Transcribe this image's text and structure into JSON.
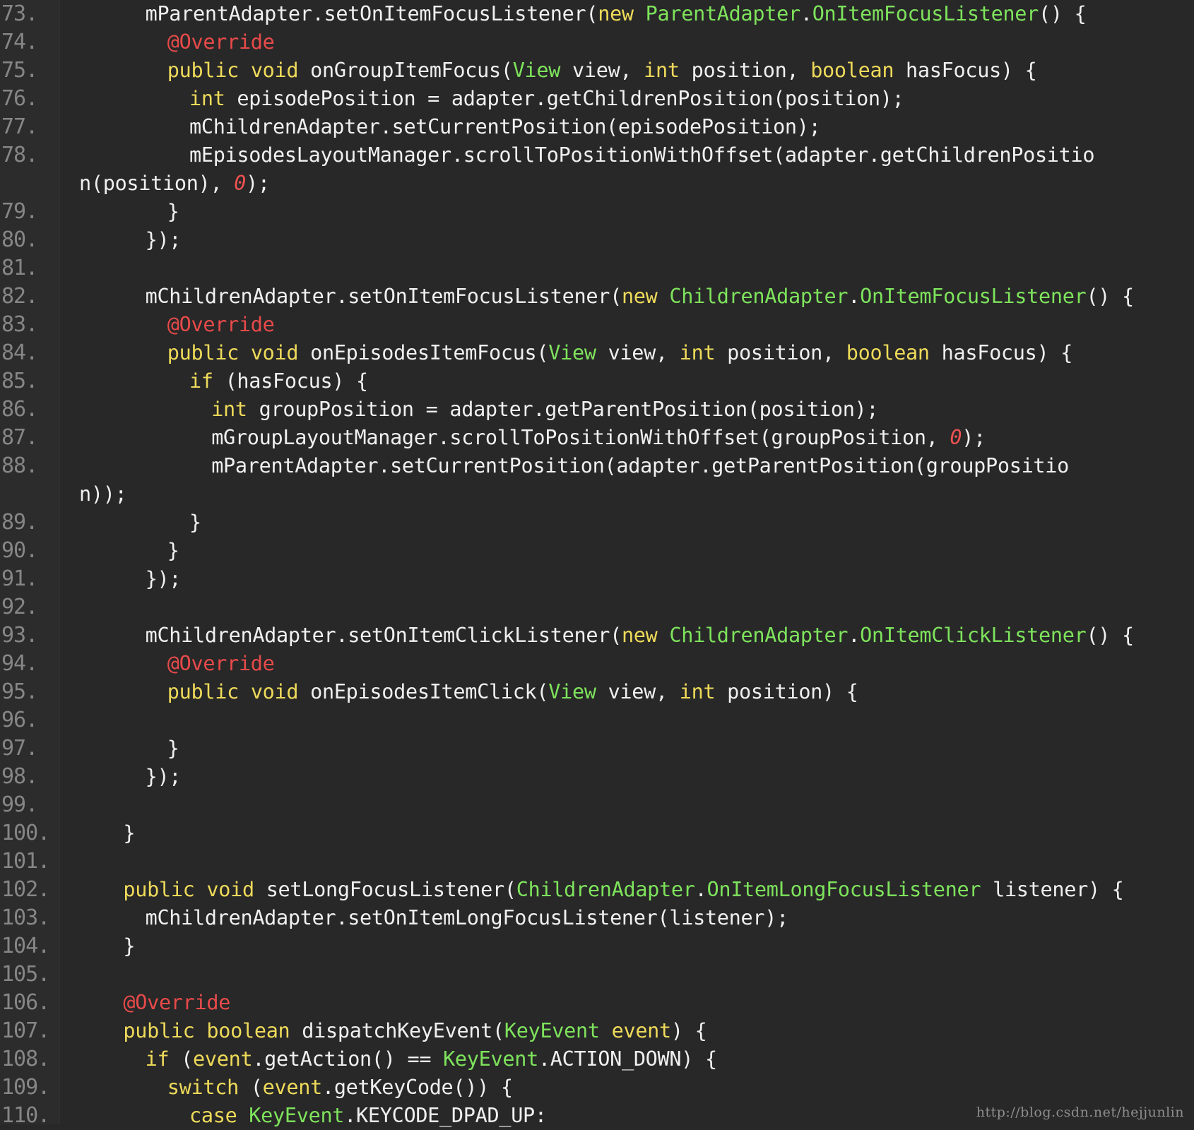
{
  "watermark": "http://blog.csdn.net/hejjunlin",
  "colors": {
    "background": "#282828",
    "text": "#f0f0f0",
    "keyword": "#eeda5a",
    "type": "#7ee35c",
    "annotation": "#e84a4a",
    "number": "#ee5151",
    "line_number": "#868686"
  },
  "lines": [
    {
      "n": "73.",
      "i": 6,
      "s": [
        [
          "mParentAdapter.setOnItemFocusListener(",
          ""
        ],
        [
          "new",
          "kw"
        ],
        [
          " ",
          ""
        ],
        [
          "ParentAdapter",
          "ty"
        ],
        [
          ".",
          ""
        ],
        [
          "OnItemFocusListener",
          "ty"
        ],
        [
          "() {",
          ""
        ]
      ]
    },
    {
      "n": "74.",
      "i": 8,
      "s": [
        [
          "@Override",
          "an"
        ]
      ]
    },
    {
      "n": "75.",
      "i": 8,
      "s": [
        [
          "public",
          "kw"
        ],
        [
          " ",
          ""
        ],
        [
          "void",
          "kw"
        ],
        [
          " onGroupItemFocus(",
          ""
        ],
        [
          "View",
          "ty"
        ],
        [
          " view, ",
          ""
        ],
        [
          "int",
          "kw"
        ],
        [
          " position, ",
          ""
        ],
        [
          "boolean",
          "kw"
        ],
        [
          " hasFocus) {",
          ""
        ]
      ]
    },
    {
      "n": "76.",
      "i": 10,
      "s": [
        [
          "int",
          "kw"
        ],
        [
          " episodePosition = adapter.getChildrenPosition(position);",
          ""
        ]
      ]
    },
    {
      "n": "77.",
      "i": 10,
      "s": [
        [
          "mChildrenAdapter.setCurrentPosition(episodePosition);",
          ""
        ]
      ]
    },
    {
      "n": "78.",
      "i": 10,
      "s": [
        [
          "mEpisodesLayoutManager.scrollToPositionWithOffset(adapter.getChildrenPositio",
          ""
        ]
      ]
    },
    {
      "n": "",
      "i": 0,
      "s": [
        [
          "n(position), ",
          ""
        ],
        [
          "0",
          "num"
        ],
        [
          ");",
          ""
        ]
      ]
    },
    {
      "n": "79.",
      "i": 8,
      "s": [
        [
          "}",
          ""
        ]
      ]
    },
    {
      "n": "80.",
      "i": 6,
      "s": [
        [
          "});",
          ""
        ]
      ]
    },
    {
      "n": "81.",
      "i": 0,
      "s": []
    },
    {
      "n": "82.",
      "i": 6,
      "s": [
        [
          "mChildrenAdapter.setOnItemFocusListener(",
          ""
        ],
        [
          "new",
          "kw"
        ],
        [
          " ",
          ""
        ],
        [
          "ChildrenAdapter",
          "ty"
        ],
        [
          ".",
          ""
        ],
        [
          "OnItemFocusListener",
          "ty"
        ],
        [
          "() {",
          ""
        ]
      ]
    },
    {
      "n": "83.",
      "i": 8,
      "s": [
        [
          "@Override",
          "an"
        ]
      ]
    },
    {
      "n": "84.",
      "i": 8,
      "s": [
        [
          "public",
          "kw"
        ],
        [
          " ",
          ""
        ],
        [
          "void",
          "kw"
        ],
        [
          " onEpisodesItemFocus(",
          ""
        ],
        [
          "View",
          "ty"
        ],
        [
          " view, ",
          ""
        ],
        [
          "int",
          "kw"
        ],
        [
          " position, ",
          ""
        ],
        [
          "boolean",
          "kw"
        ],
        [
          " hasFocus) {",
          ""
        ]
      ]
    },
    {
      "n": "85.",
      "i": 10,
      "s": [
        [
          "if",
          "kw"
        ],
        [
          " (hasFocus) {",
          ""
        ]
      ]
    },
    {
      "n": "86.",
      "i": 12,
      "s": [
        [
          "int",
          "kw"
        ],
        [
          " groupPosition = adapter.getParentPosition(position);",
          ""
        ]
      ]
    },
    {
      "n": "87.",
      "i": 12,
      "s": [
        [
          "mGroupLayoutManager.scrollToPositionWithOffset(groupPosition, ",
          ""
        ],
        [
          "0",
          "num"
        ],
        [
          ");",
          ""
        ]
      ]
    },
    {
      "n": "88.",
      "i": 12,
      "s": [
        [
          "mParentAdapter.setCurrentPosition(adapter.getParentPosition(groupPositio",
          ""
        ]
      ]
    },
    {
      "n": "",
      "i": 0,
      "s": [
        [
          "n));",
          ""
        ]
      ]
    },
    {
      "n": "89.",
      "i": 10,
      "s": [
        [
          "}",
          ""
        ]
      ]
    },
    {
      "n": "90.",
      "i": 8,
      "s": [
        [
          "}",
          ""
        ]
      ]
    },
    {
      "n": "91.",
      "i": 6,
      "s": [
        [
          "});",
          ""
        ]
      ]
    },
    {
      "n": "92.",
      "i": 0,
      "s": []
    },
    {
      "n": "93.",
      "i": 6,
      "s": [
        [
          "mChildrenAdapter.setOnItemClickListener(",
          ""
        ],
        [
          "new",
          "kw"
        ],
        [
          " ",
          ""
        ],
        [
          "ChildrenAdapter",
          "ty"
        ],
        [
          ".",
          ""
        ],
        [
          "OnItemClickListener",
          "ty"
        ],
        [
          "() {",
          ""
        ]
      ]
    },
    {
      "n": "94.",
      "i": 8,
      "s": [
        [
          "@Override",
          "an"
        ]
      ]
    },
    {
      "n": "95.",
      "i": 8,
      "s": [
        [
          "public",
          "kw"
        ],
        [
          " ",
          ""
        ],
        [
          "void",
          "kw"
        ],
        [
          " onEpisodesItemClick(",
          ""
        ],
        [
          "View",
          "ty"
        ],
        [
          " view, ",
          ""
        ],
        [
          "int",
          "kw"
        ],
        [
          " position) {",
          ""
        ]
      ]
    },
    {
      "n": "96.",
      "i": 0,
      "s": []
    },
    {
      "n": "97.",
      "i": 8,
      "s": [
        [
          "}",
          ""
        ]
      ]
    },
    {
      "n": "98.",
      "i": 6,
      "s": [
        [
          "});",
          ""
        ]
      ]
    },
    {
      "n": "99.",
      "i": 0,
      "s": []
    },
    {
      "n": "100.",
      "i": 4,
      "s": [
        [
          "}",
          ""
        ]
      ]
    },
    {
      "n": "101.",
      "i": 0,
      "s": []
    },
    {
      "n": "102.",
      "i": 4,
      "s": [
        [
          "public",
          "kw"
        ],
        [
          " ",
          ""
        ],
        [
          "void",
          "kw"
        ],
        [
          " setLongFocusListener(",
          ""
        ],
        [
          "ChildrenAdapter",
          "ty"
        ],
        [
          ".",
          ""
        ],
        [
          "OnItemLongFocusListener",
          "ty"
        ],
        [
          " listener) {",
          ""
        ]
      ]
    },
    {
      "n": "103.",
      "i": 6,
      "s": [
        [
          "mChildrenAdapter.setOnItemLongFocusListener(listener);",
          ""
        ]
      ]
    },
    {
      "n": "104.",
      "i": 4,
      "s": [
        [
          "}",
          ""
        ]
      ]
    },
    {
      "n": "105.",
      "i": 0,
      "s": []
    },
    {
      "n": "106.",
      "i": 4,
      "s": [
        [
          "@Override",
          "an"
        ]
      ]
    },
    {
      "n": "107.",
      "i": 4,
      "s": [
        [
          "public",
          "kw"
        ],
        [
          " ",
          ""
        ],
        [
          "boolean",
          "kw"
        ],
        [
          " dispatchKeyEvent(",
          ""
        ],
        [
          "KeyEvent",
          "ty"
        ],
        [
          " ",
          ""
        ],
        [
          "event",
          "kw"
        ],
        [
          ") {",
          ""
        ]
      ]
    },
    {
      "n": "108.",
      "i": 6,
      "s": [
        [
          "if",
          "kw"
        ],
        [
          " (",
          ""
        ],
        [
          "event",
          "kw"
        ],
        [
          ".getAction() == ",
          ""
        ],
        [
          "KeyEvent",
          "ty"
        ],
        [
          ".ACTION_DOWN) {",
          ""
        ]
      ]
    },
    {
      "n": "109.",
      "i": 8,
      "s": [
        [
          "switch",
          "kw"
        ],
        [
          " (",
          ""
        ],
        [
          "event",
          "kw"
        ],
        [
          ".getKeyCode()) {",
          ""
        ]
      ]
    },
    {
      "n": "110.",
      "i": 10,
      "s": [
        [
          "case",
          "kw"
        ],
        [
          " ",
          ""
        ],
        [
          "KeyEvent",
          "ty"
        ],
        [
          ".KEYCODE_DPAD_UP:",
          ""
        ]
      ]
    }
  ]
}
